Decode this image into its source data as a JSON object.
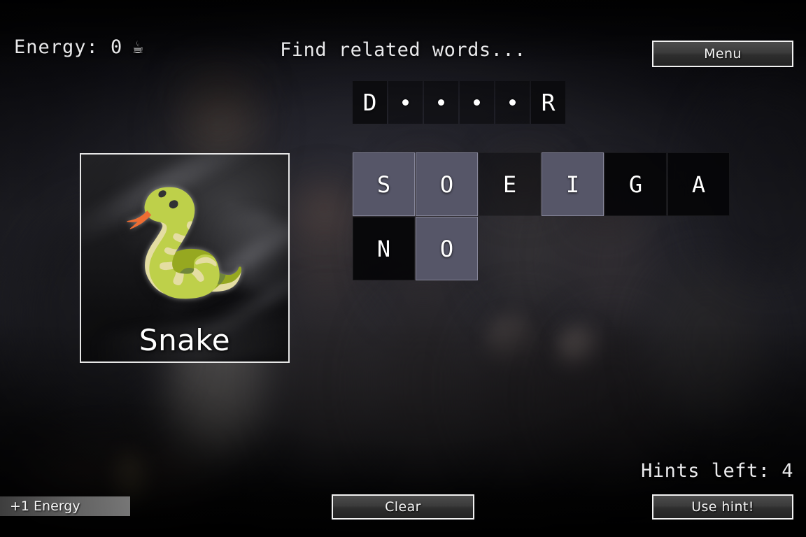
{
  "hud": {
    "energy_label": "Energy: 0",
    "energy_icon": "coffee-cup-icon",
    "energy_icon_glyph": "☕",
    "prompt": "Find related words...",
    "menu_label": "Menu"
  },
  "answer": {
    "slots": [
      {
        "char": "D",
        "revealed": true
      },
      {
        "char": "",
        "revealed": false
      },
      {
        "char": "",
        "revealed": false
      },
      {
        "char": "",
        "revealed": false
      },
      {
        "char": "",
        "revealed": false
      },
      {
        "char": "R",
        "revealed": true
      }
    ]
  },
  "tiles": {
    "rows": [
      [
        {
          "letter": "S",
          "state": "selected"
        },
        {
          "letter": "O",
          "state": "selected"
        },
        {
          "letter": "E",
          "state": "dim"
        },
        {
          "letter": "I",
          "state": "selected"
        },
        {
          "letter": "G",
          "state": "avail"
        },
        {
          "letter": "A",
          "state": "avail"
        }
      ],
      [
        {
          "letter": "N",
          "state": "avail"
        },
        {
          "letter": "O",
          "state": "selected"
        }
      ]
    ]
  },
  "clue": {
    "emoji": "🐍",
    "emoji_name": "snake-emoji",
    "label": "Snake"
  },
  "footer": {
    "hints_left": "Hints left: 4",
    "clear_label": "Clear",
    "use_hint_label": "Use hint!",
    "energy_toast": "+1 Energy"
  },
  "colors": {
    "tile_selected": "#565668",
    "tile_available": "#050507",
    "button_border": "#f2f2f2",
    "text": "#ffffff"
  }
}
